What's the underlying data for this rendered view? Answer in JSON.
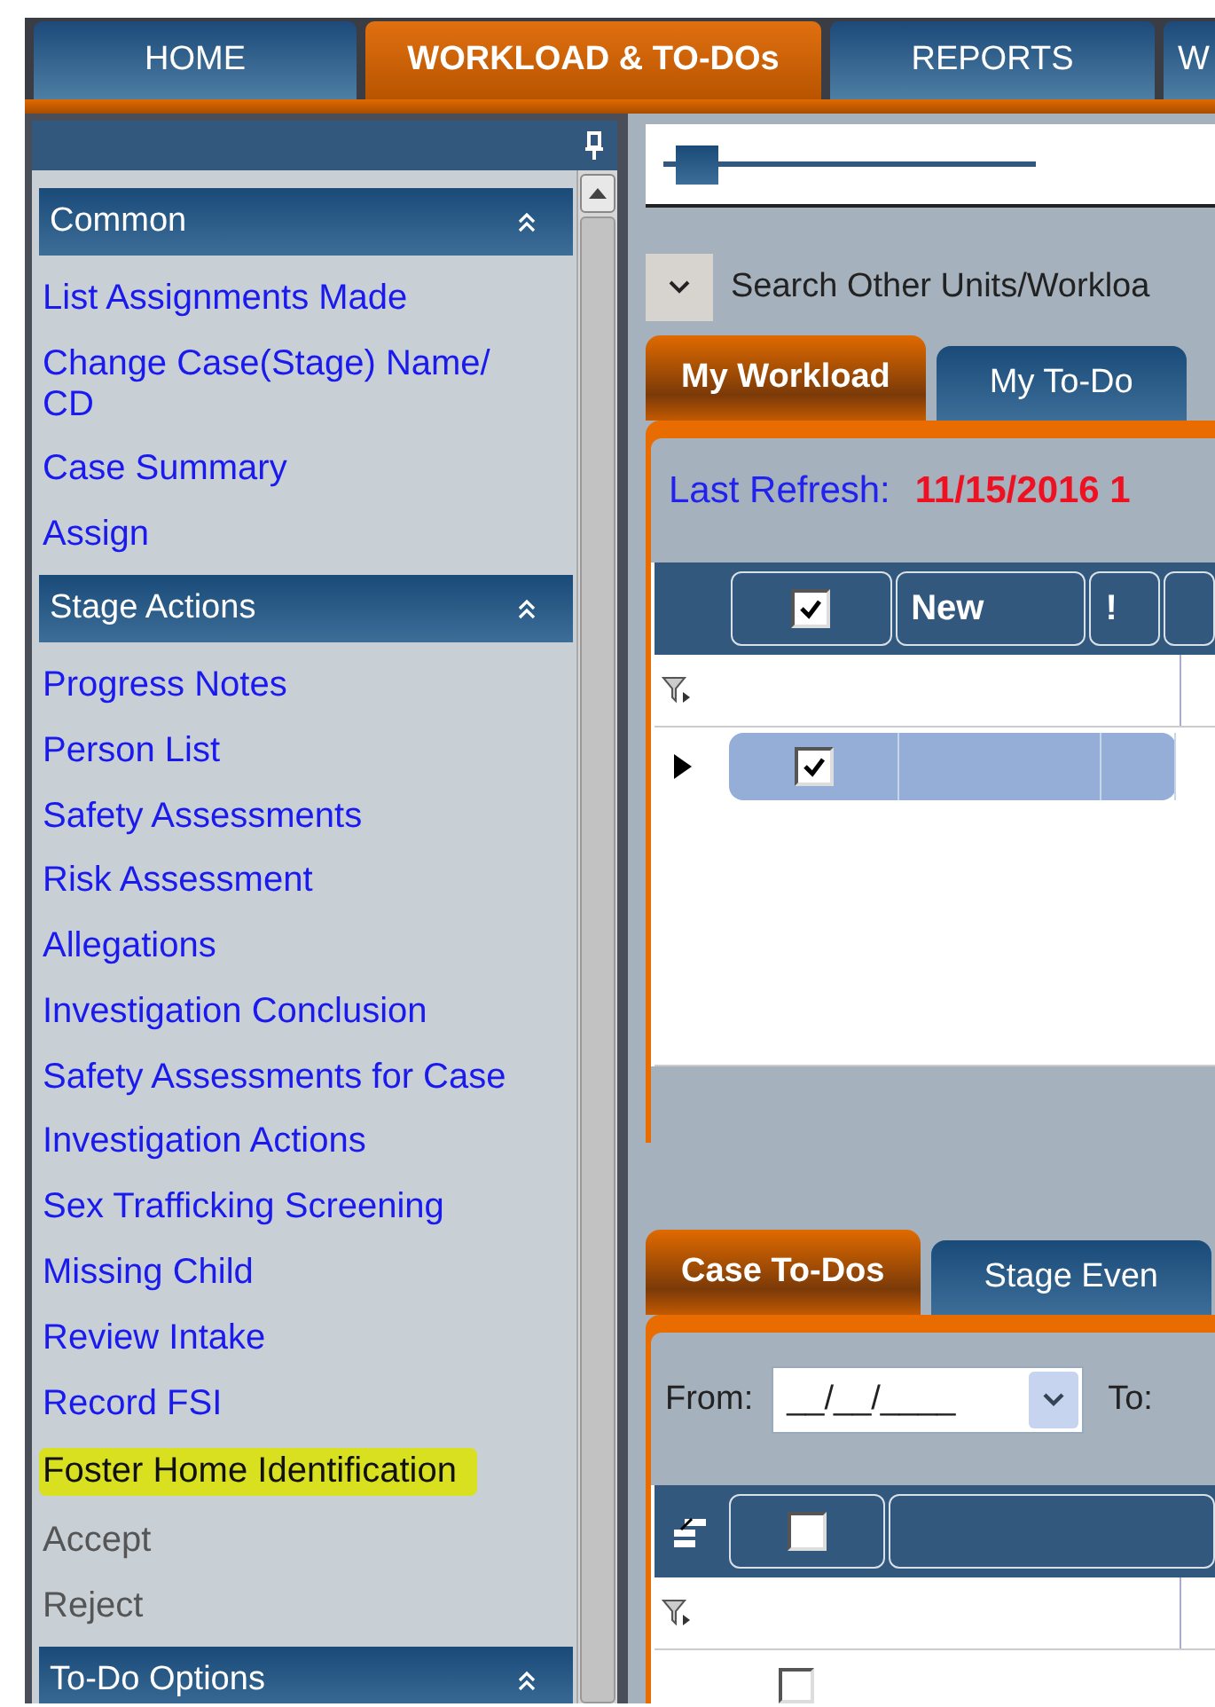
{
  "top_tabs": [
    {
      "label": "HOME",
      "selected": false
    },
    {
      "label": "WORKLOAD & TO-DOs",
      "selected": true
    },
    {
      "label": "REPORTS",
      "selected": false
    },
    {
      "label": "W",
      "selected": false
    }
  ],
  "sidebar": {
    "sections": [
      {
        "title": "Common",
        "expanded": true,
        "items": [
          {
            "label": "List Assignments Made",
            "disabled": false,
            "highlighted": false
          },
          {
            "label": "Change Case(Stage) Name/ CD",
            "disabled": false,
            "highlighted": false
          },
          {
            "label": "Case Summary",
            "disabled": false,
            "highlighted": false
          },
          {
            "label": "Assign",
            "disabled": false,
            "highlighted": false
          }
        ]
      },
      {
        "title": "Stage Actions",
        "expanded": true,
        "items": [
          {
            "label": "Progress Notes",
            "disabled": false,
            "highlighted": false
          },
          {
            "label": "Person List",
            "disabled": false,
            "highlighted": false
          },
          {
            "label": "Safety Assessments",
            "disabled": false,
            "highlighted": false
          },
          {
            "label": "Risk Assessment",
            "disabled": false,
            "highlighted": false
          },
          {
            "label": "Allegations",
            "disabled": false,
            "highlighted": false
          },
          {
            "label": "Investigation Conclusion",
            "disabled": false,
            "highlighted": false
          },
          {
            "label": "Safety Assessments for Case",
            "disabled": false,
            "highlighted": false
          },
          {
            "label": "Investigation Actions",
            "disabled": false,
            "highlighted": false
          },
          {
            "label": "Sex Trafficking Screening",
            "disabled": false,
            "highlighted": false
          },
          {
            "label": "Missing Child",
            "disabled": false,
            "highlighted": false
          },
          {
            "label": "Review Intake",
            "disabled": false,
            "highlighted": false
          },
          {
            "label": "Record FSI",
            "disabled": false,
            "highlighted": false
          },
          {
            "label": "Foster Home Identification",
            "disabled": false,
            "highlighted": true
          },
          {
            "label": "Accept",
            "disabled": true,
            "highlighted": false
          },
          {
            "label": "Reject",
            "disabled": true,
            "highlighted": false
          }
        ]
      },
      {
        "title": "To-Do Options",
        "expanded": true
      }
    ]
  },
  "slider": {
    "level": 0.05
  },
  "search_other": {
    "label": "Search Other Units/Workloa"
  },
  "workload": {
    "tabs": [
      {
        "label": "My Workload",
        "selected": true
      },
      {
        "label": "My To-Do",
        "selected": false
      }
    ],
    "refresh_label": "Last Refresh:",
    "refresh_value": "11/15/2016 1",
    "table": {
      "columns": [
        {
          "kind": "check",
          "checked": true
        },
        {
          "kind": "text",
          "label": "New"
        },
        {
          "kind": "text",
          "label": "!"
        }
      ],
      "rows": [
        {
          "checked": true,
          "selected": true
        }
      ]
    }
  },
  "todos": {
    "tabs": [
      {
        "label": "Case To-Dos",
        "selected": true
      },
      {
        "label": "Stage Even",
        "selected": false
      }
    ],
    "from_label": "From:",
    "from_value": "__/__/____",
    "to_label": "To:",
    "table": {
      "header_checked": false,
      "rows": [
        {
          "checked": false
        }
      ]
    }
  }
}
